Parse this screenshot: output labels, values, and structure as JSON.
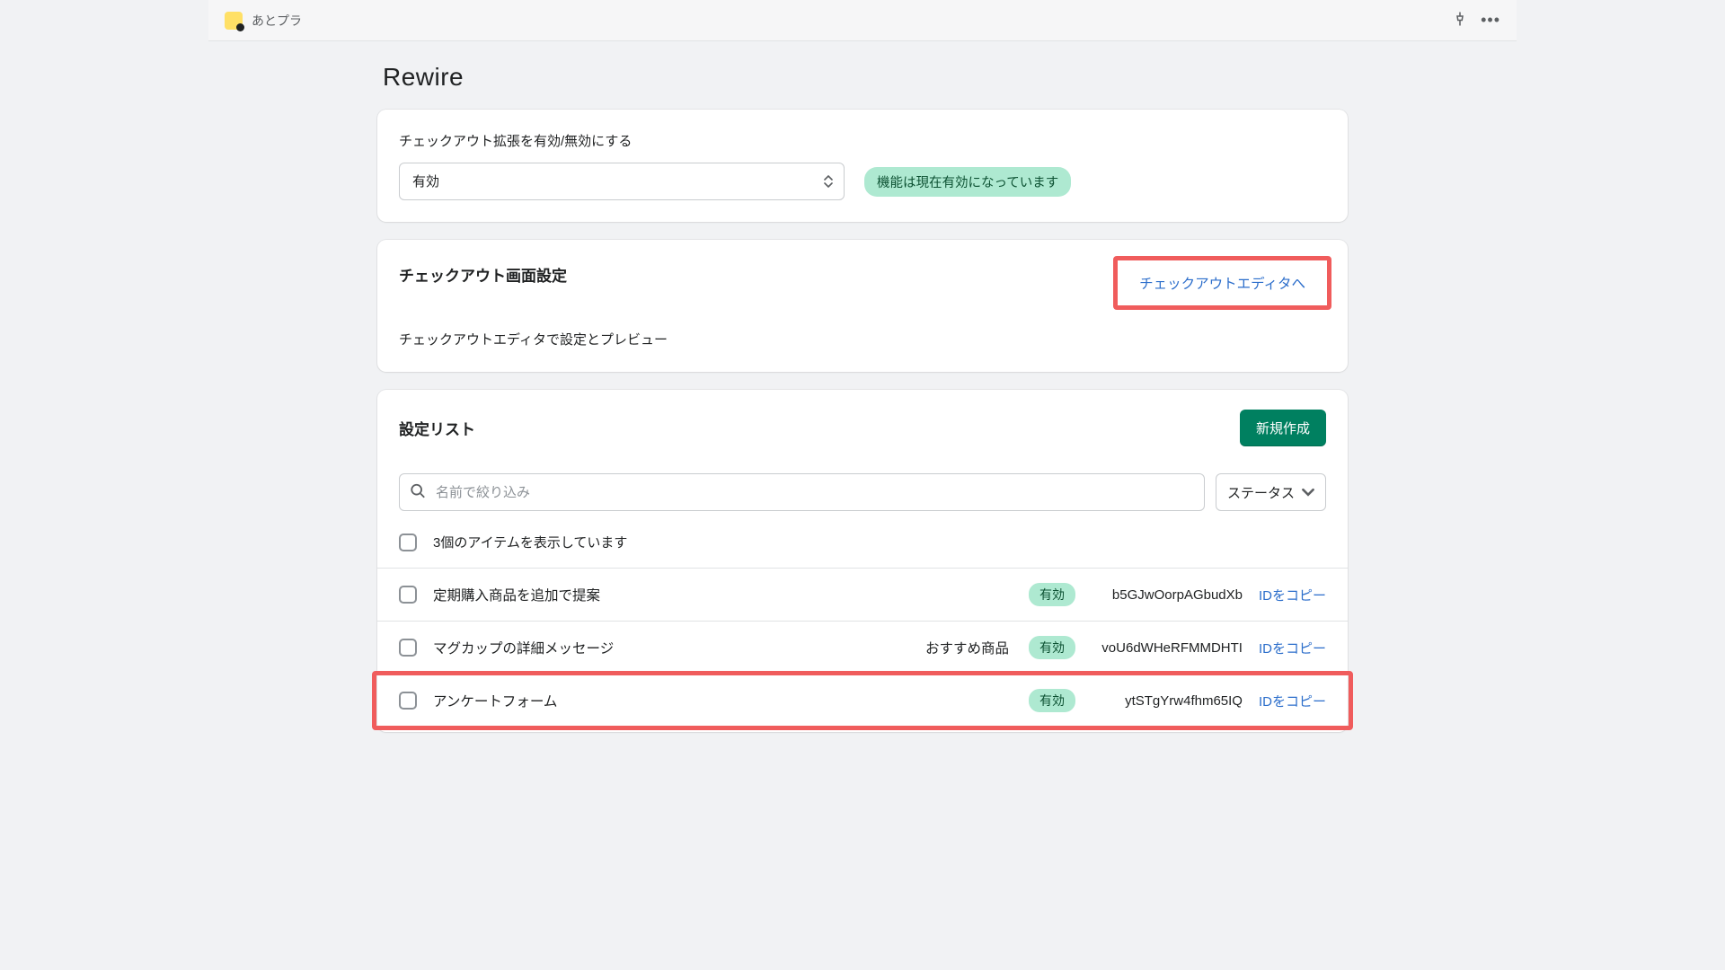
{
  "tab": {
    "title": "あとプラ"
  },
  "page": {
    "title": "Rewire"
  },
  "enable_card": {
    "label": "チェックアウト拡張を有効/無効にする",
    "select_value": "有効",
    "badge": "機能は現在有効になっています"
  },
  "screen_card": {
    "title": "チェックアウト画面設定",
    "link": "チェックアウトエディタへ",
    "sub": "チェックアウトエディタで設定とプレビュー"
  },
  "list_card": {
    "title": "設定リスト",
    "new_label": "新規作成",
    "search_placeholder": "名前で絞り込み",
    "status_filter_label": "ステータス",
    "header_text": "3個のアイテムを表示しています",
    "copy_label": "IDをコピー",
    "rows": [
      {
        "name": "定期購入商品を追加で提案",
        "sub": "",
        "status": "有効",
        "id": "b5GJwOorpAGbudXb",
        "highlight": false
      },
      {
        "name": "マグカップの詳細メッセージ",
        "sub": "おすすめ商品",
        "status": "有効",
        "id": "voU6dWHeRFMMDHTI",
        "highlight": false
      },
      {
        "name": "アンケートフォーム",
        "sub": "",
        "status": "有効",
        "id": "ytSTgYrw4fhm65IQ",
        "highlight": true
      }
    ]
  }
}
